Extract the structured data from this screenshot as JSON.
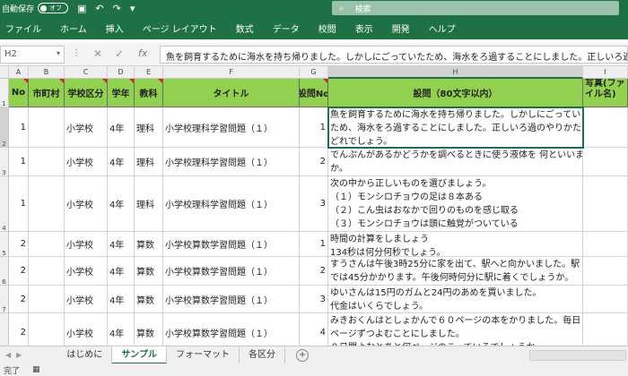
{
  "titlebar": {
    "autosave_label": "自動保存",
    "autosave_state": "オフ",
    "search_placeholder": "検索"
  },
  "ribbon_tabs": [
    "ファイル",
    "ホーム",
    "挿入",
    "ページ レイアウト",
    "数式",
    "データ",
    "校閲",
    "表示",
    "開発",
    "ヘルプ"
  ],
  "formula_bar": {
    "name_box": "H2",
    "fx": "fx",
    "content": "魚を飼育するために海水を持ち帰りました。しかしにごっていたため、海水をろ過することにしました。正しいろ過のやりかたは"
  },
  "columns": [
    "A",
    "B",
    "C",
    "D",
    "E",
    "F",
    "G",
    "H",
    "I"
  ],
  "rows": [
    "1",
    "2",
    "3",
    "4",
    "5",
    "6",
    "7",
    "8"
  ],
  "headers": {
    "no": "No",
    "city": "市町村",
    "school_type": "学校区分",
    "grade": "学年",
    "subject": "教科",
    "title": "タイトル",
    "question_no": "設問No",
    "question": "設問（80文字以内）",
    "photo": "写真(ファイル名)"
  },
  "table": [
    {
      "no": "1",
      "school_type": "小学校",
      "grade": "4年",
      "subject": "理科",
      "title": "小学校理科学習問題（１）",
      "qno": "1",
      "lines": [
        "魚を飼育するために海水を持ち帰りました。しかしにごってい",
        "ため、海水をろ過することにしました。正しいろ過のやりかた",
        "どれでしょう。"
      ]
    },
    {
      "no": "1",
      "school_type": "小学校",
      "grade": "4年",
      "subject": "理科",
      "title": "小学校理科学習問題（１）",
      "qno": "2",
      "lines": [
        "でんぷんがあるかどうかを調べるときに使う液体を 何といいま",
        "か。"
      ]
    },
    {
      "no": "1",
      "school_type": "小学校",
      "grade": "4年",
      "subject": "理科",
      "title": "小学校理科学習問題（１）",
      "qno": "3",
      "lines": [
        "次の中から正しいものを選びましょう。",
        "（１）モンシロチョウの足は８本ある",
        "（２）こん虫はおなかで回りのものを感じ取る",
        "（３）モンシロチョウは頭に触覚がついている"
      ]
    },
    {
      "no": "2",
      "school_type": "小学校",
      "grade": "4年",
      "subject": "算数",
      "title": "小学校算数学習問題（１）",
      "qno": "1",
      "lines": [
        "時間の計算をしましょう",
        "134秒は何分何秒でしょう。"
      ]
    },
    {
      "no": "2",
      "school_type": "小学校",
      "grade": "4年",
      "subject": "算数",
      "title": "小学校算数学習問題（１）",
      "qno": "2",
      "lines": [
        "すうさんは午後3時25分に家を出て、駅へと向かいました。駅",
        "では45分かかります。午後何時何分に駅に着くでしょうか。"
      ]
    },
    {
      "no": "2",
      "school_type": "小学校",
      "grade": "4年",
      "subject": "算数",
      "title": "小学校算数学習問題（１）",
      "qno": "3",
      "lines": [
        "ゆいさんは15円のガムと24円のあめを買いました。",
        "代金はいくらでしょう。"
      ]
    },
    {
      "no": "2",
      "school_type": "小学校",
      "grade": "4年",
      "subject": "算数",
      "title": "小学校算数学習問題（１）",
      "qno": "4",
      "lines": [
        "みきおくんはとしょかんで６０ページの本をかりました。毎日６",
        "ページずつよむことにしました。",
        "８日間よむとあと何ページのこっているでしょうか。"
      ]
    }
  ],
  "sheet_tabs": [
    "はじめに",
    "サンプル",
    "フォーマット",
    "各区分"
  ],
  "active_tab": "サンプル",
  "status": {
    "ready": "完了"
  }
}
